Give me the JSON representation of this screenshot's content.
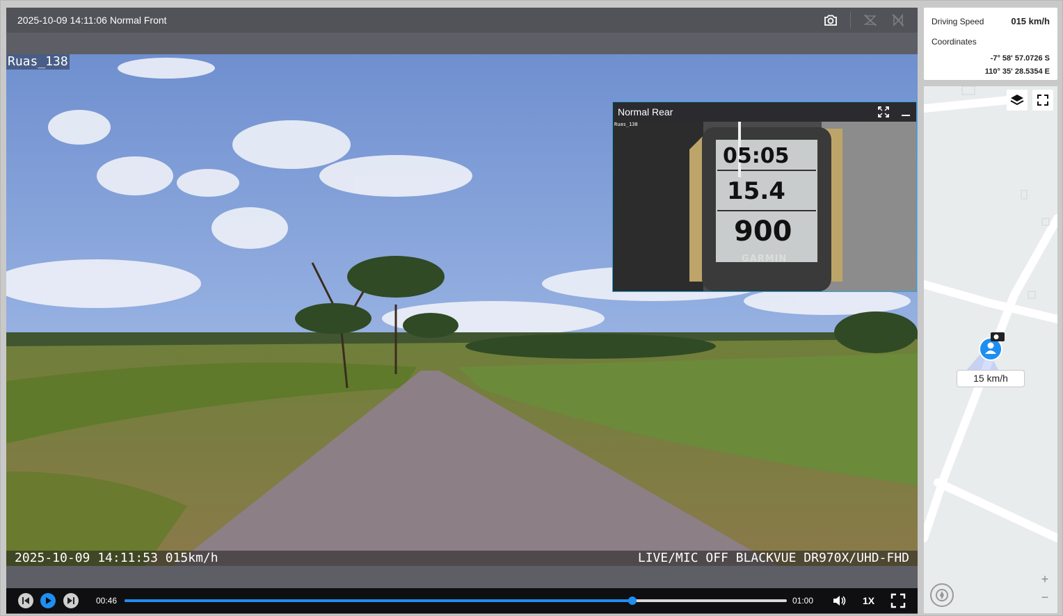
{
  "player": {
    "title": "2025-10-09 14:11:06 Normal Front",
    "front": {
      "channel": "Ruas_138",
      "osd_left": "2025-10-09 14:11:53 015km/h",
      "osd_right": "LIVE/MIC OFF BLACKVUE DR970X/UHD-FHD"
    },
    "rear": {
      "title": "Normal Rear",
      "channel": "Ruas_138",
      "gps_time": "05:05",
      "gps_speed": "15.4",
      "gps_distance": "900",
      "gps_brand": "GARMIN"
    },
    "controls": {
      "current_time": "00:46",
      "total_time": "01:00",
      "progress": 0.767,
      "playback_speed": "1X"
    }
  },
  "info": {
    "speed_label": "Driving Speed",
    "speed_value": "015 km/h",
    "coord_label": "Coordinates",
    "latitude": "-7° 58' 57.0726 S",
    "longitude": "110° 35' 28.5354 E"
  },
  "map": {
    "speed_tag": "15 km/h",
    "zoom_in": "+",
    "zoom_out": "−"
  },
  "colors": {
    "accent": "#1f8ef1",
    "pip_border": "#2aa6e0"
  }
}
